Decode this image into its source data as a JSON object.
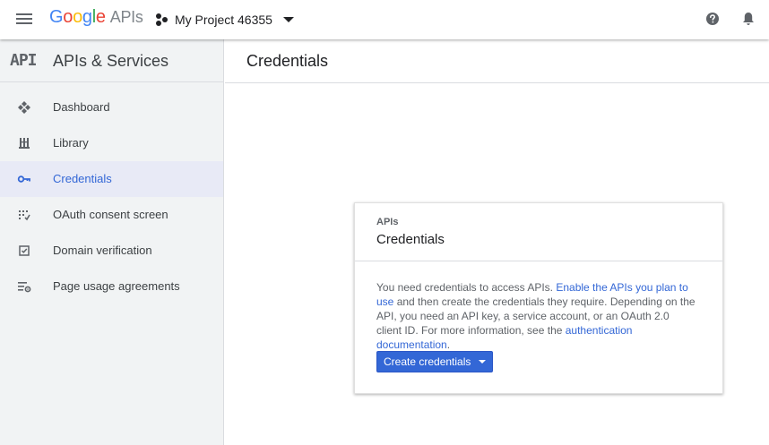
{
  "header": {
    "logo_letters": [
      "G",
      "o",
      "o",
      "g",
      "l",
      "e"
    ],
    "logo_suffix": "APIs",
    "project_name": "My Project 46355",
    "icons": [
      "menu-icon",
      "project-icon",
      "help-icon",
      "notifications-icon"
    ]
  },
  "sidebar": {
    "logo_text": "API",
    "title": "APIs & Services",
    "items": [
      {
        "label": "Dashboard",
        "icon": "dashboard-icon",
        "active": false
      },
      {
        "label": "Library",
        "icon": "library-icon",
        "active": false
      },
      {
        "label": "Credentials",
        "icon": "key-icon",
        "active": true
      },
      {
        "label": "OAuth consent screen",
        "icon": "consent-icon",
        "active": false
      },
      {
        "label": "Domain verification",
        "icon": "checkbox-icon",
        "active": false
      },
      {
        "label": "Page usage agreements",
        "icon": "settings-list-icon",
        "active": false
      }
    ]
  },
  "page": {
    "title": "Credentials"
  },
  "card": {
    "eyebrow": "APIs",
    "title": "Credentials",
    "text_1": "You need credentials to access APIs. ",
    "link_1": "Enable the APIs you plan to use",
    "text_2": " and then create the credentials they require. Depending on the API, you need an API key, a service account, or an OAuth 2.0 client ID. For more information, see the ",
    "link_2": "authentication documentation",
    "text_3": ".",
    "button_label": "Create credentials"
  },
  "colors": {
    "accent": "#3367d6",
    "active_bg": "#e8eaf6",
    "sidebar_bg": "#f1f3f4"
  }
}
